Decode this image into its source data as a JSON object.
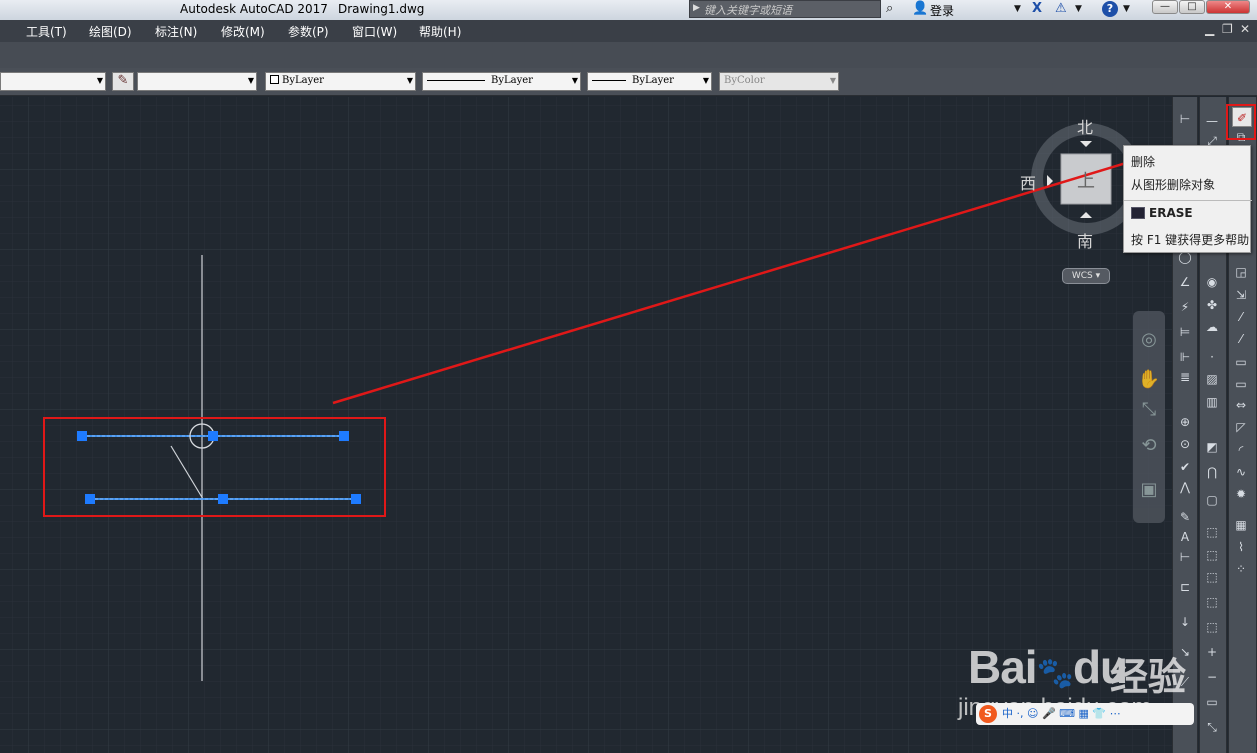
{
  "titlebar": {
    "app_title": "Autodesk AutoCAD 2017",
    "doc_name": "Drawing1.dwg",
    "search_placeholder": "键入关键字或短语",
    "login": "登录"
  },
  "menu": [
    "工具(T)",
    "绘图(D)",
    "标注(N)",
    "修改(M)",
    "参数(P)",
    "窗口(W)",
    "帮助(H)"
  ],
  "properties": {
    "color": "ByLayer",
    "linetype": "ByLayer",
    "lineweight": "ByLayer",
    "plotstyle": "ByColor"
  },
  "viewcube": {
    "north": "北",
    "south": "南",
    "west": "西",
    "face": "上",
    "wcs": "WCS"
  },
  "tooltip": {
    "title": "删除",
    "description": "从图形删除对象",
    "command": "ERASE",
    "help": "按 F1 键获得更多帮助"
  },
  "watermark": {
    "brand": "Bai",
    "brand_du": "du",
    "suffix": "经验",
    "url": "jingyan.baidu.com"
  },
  "colors": {
    "canvas_bg": "#212830",
    "selection": "#3f8fe8",
    "grip": "#1e7bff",
    "annotation": "#e01818"
  }
}
